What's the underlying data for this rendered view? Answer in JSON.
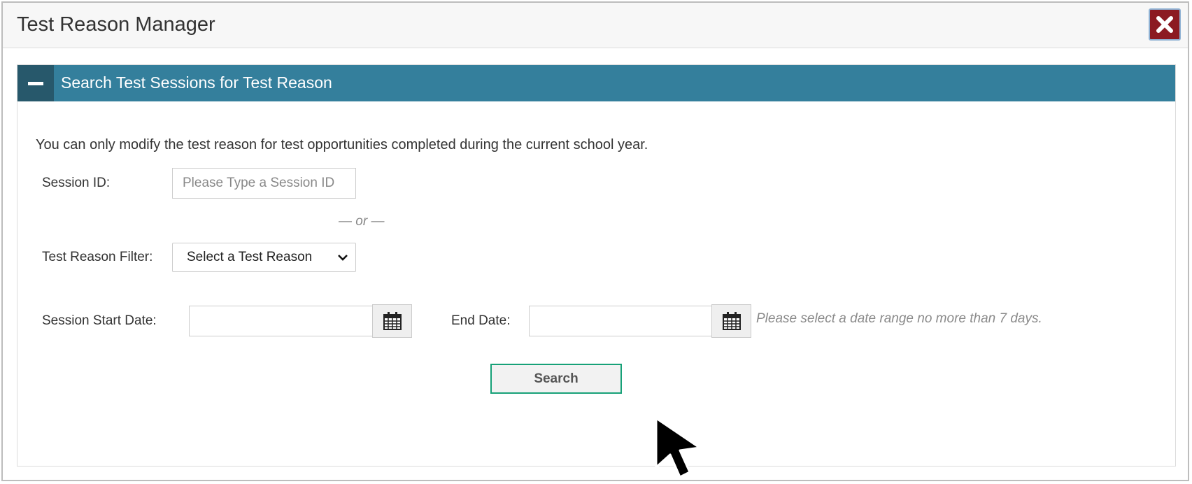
{
  "modal": {
    "title": "Test Reason Manager",
    "close_icon": "close-x-icon"
  },
  "panel": {
    "title": "Search Test Sessions for Test Reason",
    "collapse_icon": "minus-icon"
  },
  "notice": "You can only modify the test reason for test opportunities completed during the current school year.",
  "session_id": {
    "label": "Session ID:",
    "value": "",
    "placeholder": "Please Type a Session ID"
  },
  "or_separator": "— or —",
  "test_reason": {
    "label": "Test Reason Filter:",
    "selected": "Select a Test Reason"
  },
  "start_date": {
    "label": "Session Start Date:",
    "value": "",
    "icon": "calendar-icon"
  },
  "end_date": {
    "label": "End Date:",
    "value": "",
    "icon": "calendar-icon"
  },
  "date_hint": "Please select a date range no more than 7 days.",
  "search_button": "Search",
  "colors": {
    "panel_header": "#347f9c",
    "collapse_button": "#27586b",
    "close_button": "#8c1a22",
    "search_border": "#17a178"
  }
}
